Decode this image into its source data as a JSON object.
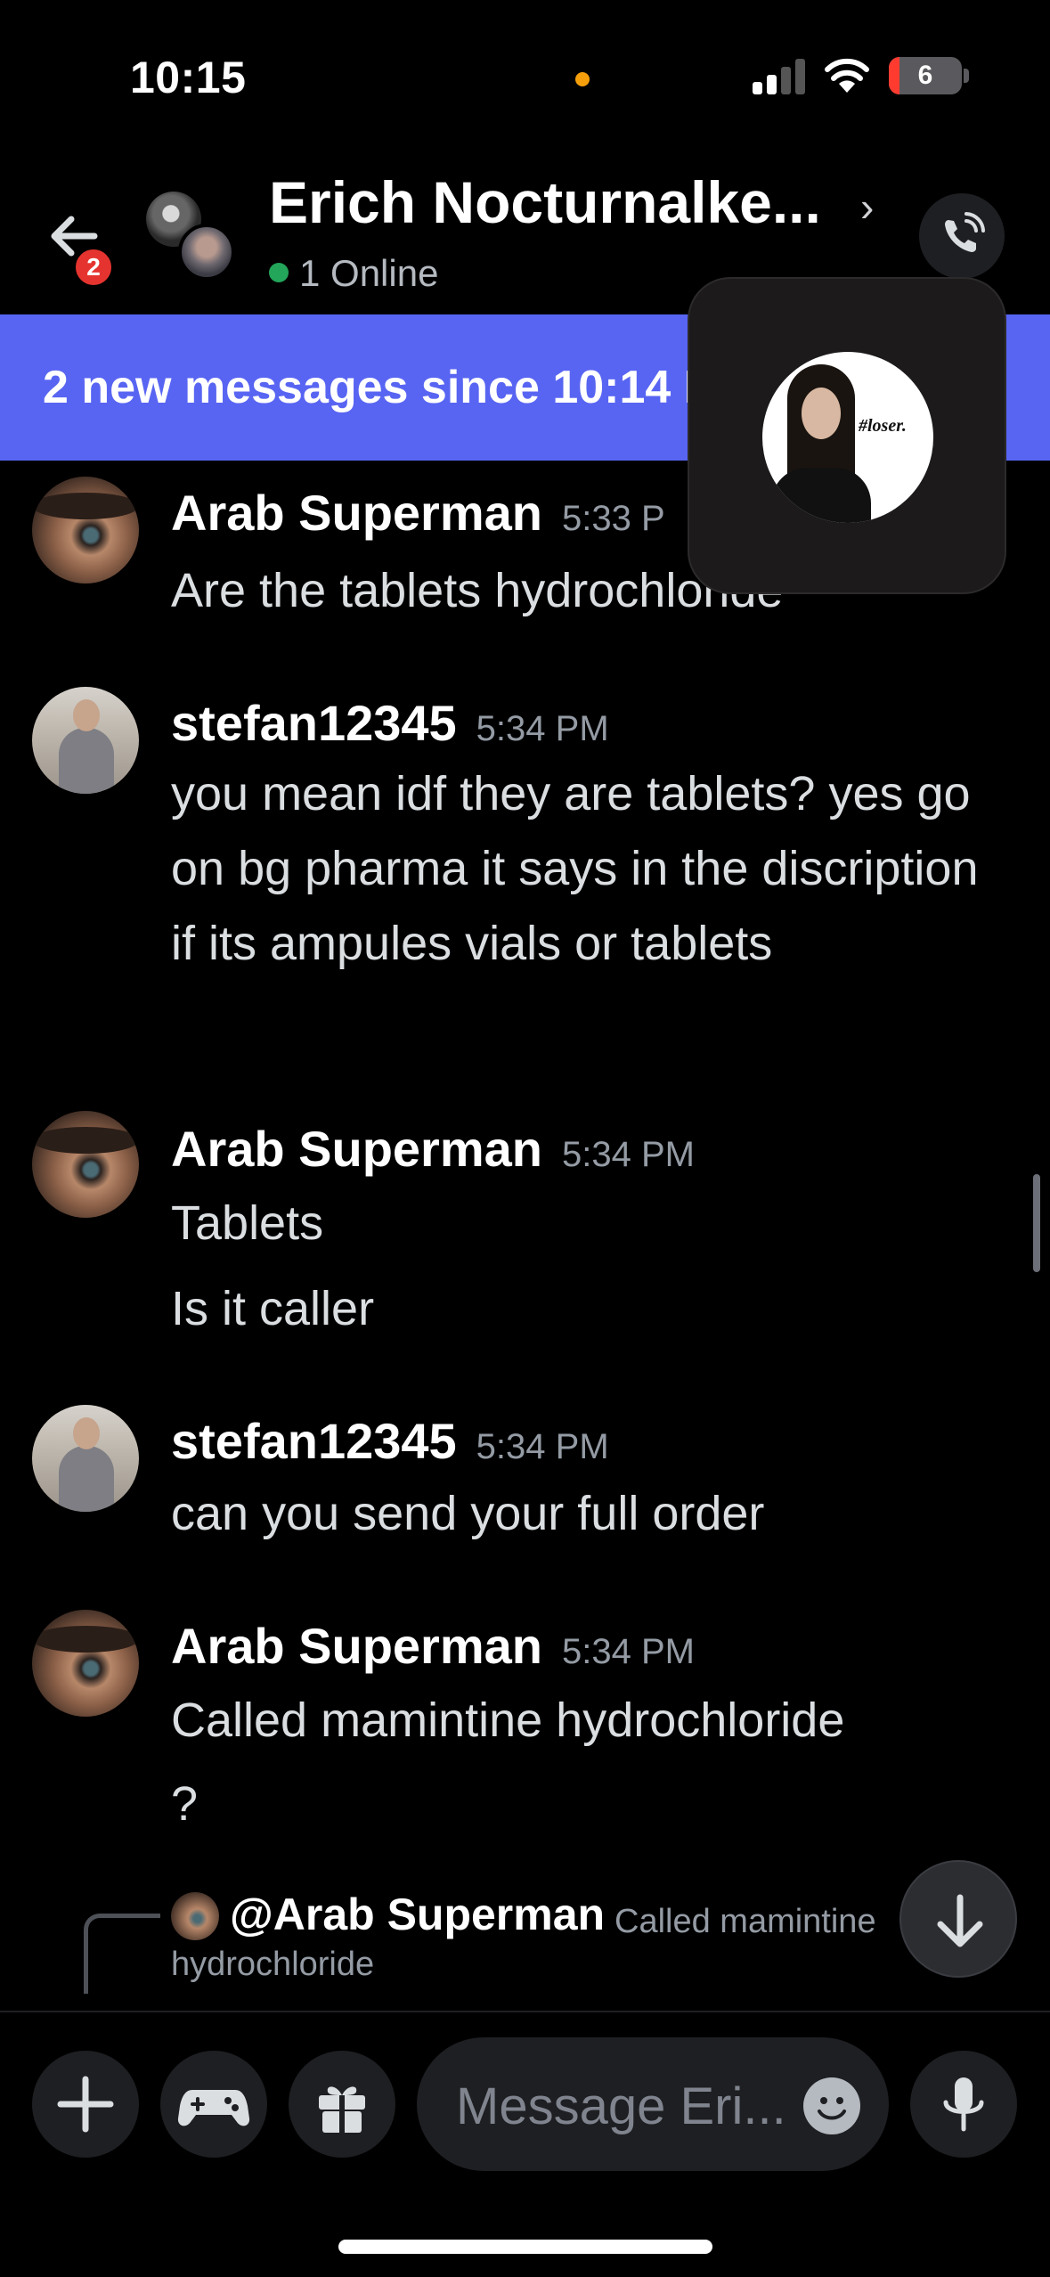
{
  "status_bar": {
    "time": "10:15",
    "battery": "6",
    "signal_bars": 2,
    "icons": [
      "cellular-signal-icon",
      "wifi-icon",
      "battery-icon"
    ],
    "recording_indicator_color": "#f59e0b"
  },
  "header": {
    "back_badge": "2",
    "title": "Erich Nocturnalke...",
    "online_status": "1 Online",
    "online_color": "#23a55a"
  },
  "banner": {
    "text": "2 new messages since 10:14 P",
    "color": "#5865f2"
  },
  "pip": {
    "label": "#loser."
  },
  "messages": [
    {
      "author": "Arab Superman",
      "time": "5:33 P",
      "lines": [
        "Are the tablets hydrochloride"
      ]
    },
    {
      "author": "stefan12345",
      "time": "5:34 PM",
      "lines": [
        "you mean idf they are tablets? yes go on bg pharma it says in the discription if its ampules vials or tablets"
      ]
    },
    {
      "author": "Arab Superman",
      "time": "5:34 PM",
      "lines": [
        "Tablets",
        "Is it caller"
      ]
    },
    {
      "author": "stefan12345",
      "time": "5:34 PM",
      "lines": [
        "can you send your full order"
      ]
    },
    {
      "author": "Arab Superman",
      "time": "5:34 PM",
      "lines": [
        "Called mamintine hydrochloride",
        "?"
      ]
    }
  ],
  "reply": {
    "mention": "@Arab Superman",
    "snippet_line1": "Called mamintine",
    "snippet_line2": "hydrochloride"
  },
  "composer": {
    "placeholder": "Message Eri...",
    "buttons": [
      "plus-icon",
      "gamepad-icon",
      "gift-icon",
      "emoji-icon",
      "microphone-icon"
    ]
  }
}
